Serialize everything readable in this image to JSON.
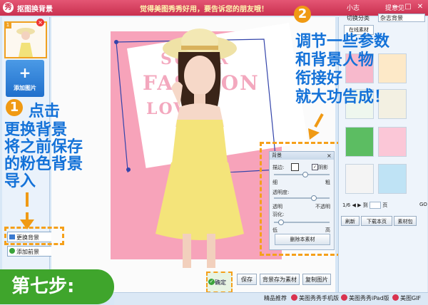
{
  "titlebar": {
    "icon_glyph": "秀",
    "title": "抠图换背景",
    "promo": "觉得美图秀秀好用，要告诉您的朋友哦！",
    "user": "小志",
    "tips": "提意见",
    "minimize": "—",
    "maximize": "□",
    "close": "✕"
  },
  "left_panel": {
    "thumb_index": "1",
    "add_image_plus": "+",
    "add_image_label": "添加图片",
    "change_bg_label": "更换背景",
    "add_bg_label": "添加前景"
  },
  "canvas": {
    "bg_color": "#f7a3ba",
    "text_line1": "SUPER",
    "text_line2": "FASHION",
    "text_line3": "LOVE"
  },
  "bottom_buttons": {
    "confirm": "确定",
    "save": "保存",
    "save_as_bg": "背景存为素材",
    "copy_image": "复制图片"
  },
  "params_panel": {
    "title": "背景",
    "border_label": "描边:",
    "shadow_label": "阴影",
    "thin": "细",
    "thick": "粗",
    "opacity_label": "透明度:",
    "transparent": "透明",
    "opaque": "不透明",
    "feather_label": "羽化:",
    "low": "低",
    "high": "高",
    "delete_material": "删除本素材"
  },
  "right_panel": {
    "category_label": "切换分类",
    "category_value": "杂志背景",
    "tab_online": "在线素材",
    "pager_prefix": "1/6",
    "pager_to": "到",
    "pager_page": "页",
    "go": "GO",
    "refresh": "刷新",
    "download_page": "下载本页",
    "material_pack": "素材包"
  },
  "annotations": {
    "badge1": "1",
    "badge2": "2",
    "step1_line1": "点击",
    "step1_line2": "更换背景",
    "step1_line3": "将之前保存",
    "step1_line4": "的粉色背景",
    "step1_line5": "导入",
    "step2_line1": "调节一些参数",
    "step2_line2": "和背景人物",
    "step2_line3": "衔接好",
    "step2_line4": "就大功告成！",
    "step_ribbon": "第七步:"
  },
  "statusbar": {
    "recommend": "精品推荐",
    "mobile": "美图秀秀手机版",
    "ipad": "美图秀秀iPad版",
    "gif": "美图GIF"
  },
  "colors": {
    "title_bar": "#d03253",
    "annotation_blue": "#1472d8",
    "annotation_orange": "#f09a14",
    "ribbon_green": "#3fa52c"
  }
}
